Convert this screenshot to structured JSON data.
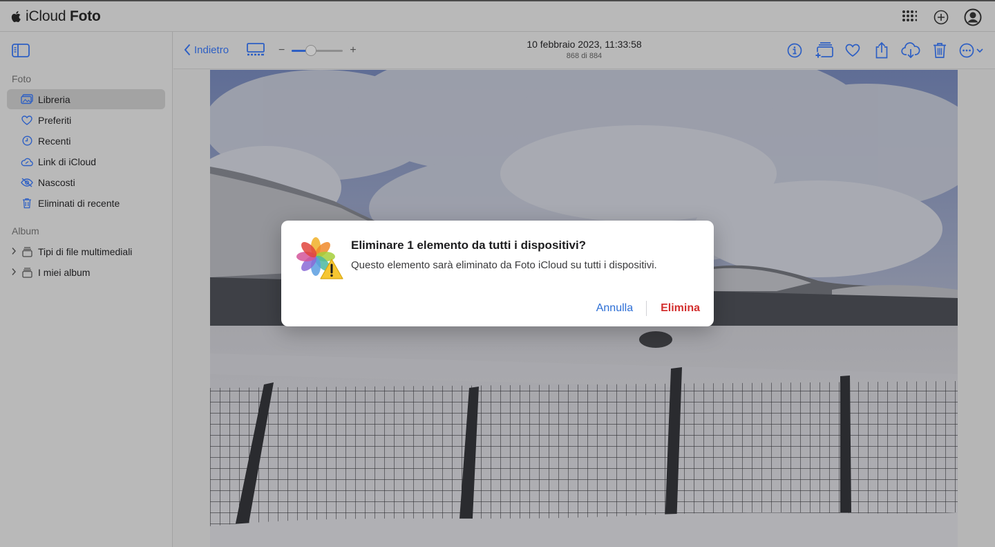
{
  "app": {
    "brand_prefix": "iCloud",
    "brand_name": "Foto"
  },
  "sidebar": {
    "section_photos": "Foto",
    "items": [
      {
        "label": "Libreria",
        "icon": "library-icon"
      },
      {
        "label": "Preferiti",
        "icon": "heart-icon"
      },
      {
        "label": "Recenti",
        "icon": "clock-icon"
      },
      {
        "label": "Link di iCloud",
        "icon": "cloud-link-icon"
      },
      {
        "label": "Nascosti",
        "icon": "eye-slash-icon"
      },
      {
        "label": "Eliminati di recente",
        "icon": "trash-icon"
      }
    ],
    "section_albums": "Album",
    "albums": [
      {
        "label": "Tipi di file multimediali",
        "icon": "album-stack-icon"
      },
      {
        "label": "I miei album",
        "icon": "album-stack-icon"
      }
    ]
  },
  "toolbar": {
    "back_label": "Indietro",
    "zoom_minus": "−",
    "zoom_plus": "+",
    "zoom_level": 0.38,
    "date": "10 febbraio 2023, 11:33:58",
    "count": "868 di 884"
  },
  "dialog": {
    "title": "Eliminare 1 elemento da tutti i dispositivi?",
    "message": "Questo elemento sarà eliminato da Foto iCloud su tutti i dispositivi.",
    "cancel_label": "Annulla",
    "delete_label": "Elimina"
  },
  "colors": {
    "accent": "#2d5fc4",
    "destructive": "#d3302f"
  }
}
